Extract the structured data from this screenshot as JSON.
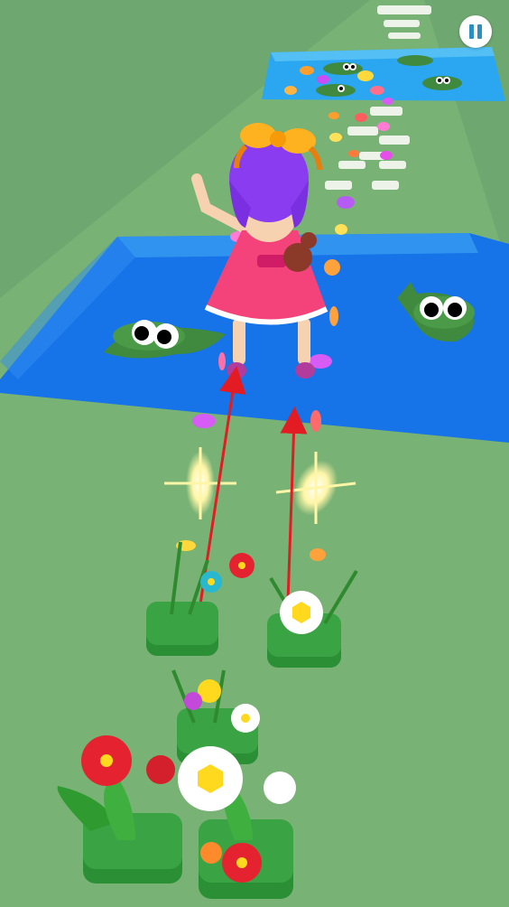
{
  "game": {
    "hud": {
      "pause_icon": "pause-icon"
    },
    "colors": {
      "ground": "#6fa771",
      "path": "#7cb67a",
      "water": "#1a78ee",
      "water_light": "#2f9ff4",
      "crocodile": "#3f8a3f",
      "dress": "#f4437a",
      "hair": "#8a3df0",
      "bow": "#ffb21f",
      "trajectory_arrow": "#e21c22",
      "sparkle": "#fff3a0",
      "accent": "#2b8fbf"
    },
    "scene_objects": [
      "player-girl",
      "crocodile-left",
      "crocodile-right",
      "far-crocodiles",
      "water-pond",
      "flower-tiles",
      "butterflies",
      "sparkles",
      "trajectory-arrows"
    ]
  }
}
